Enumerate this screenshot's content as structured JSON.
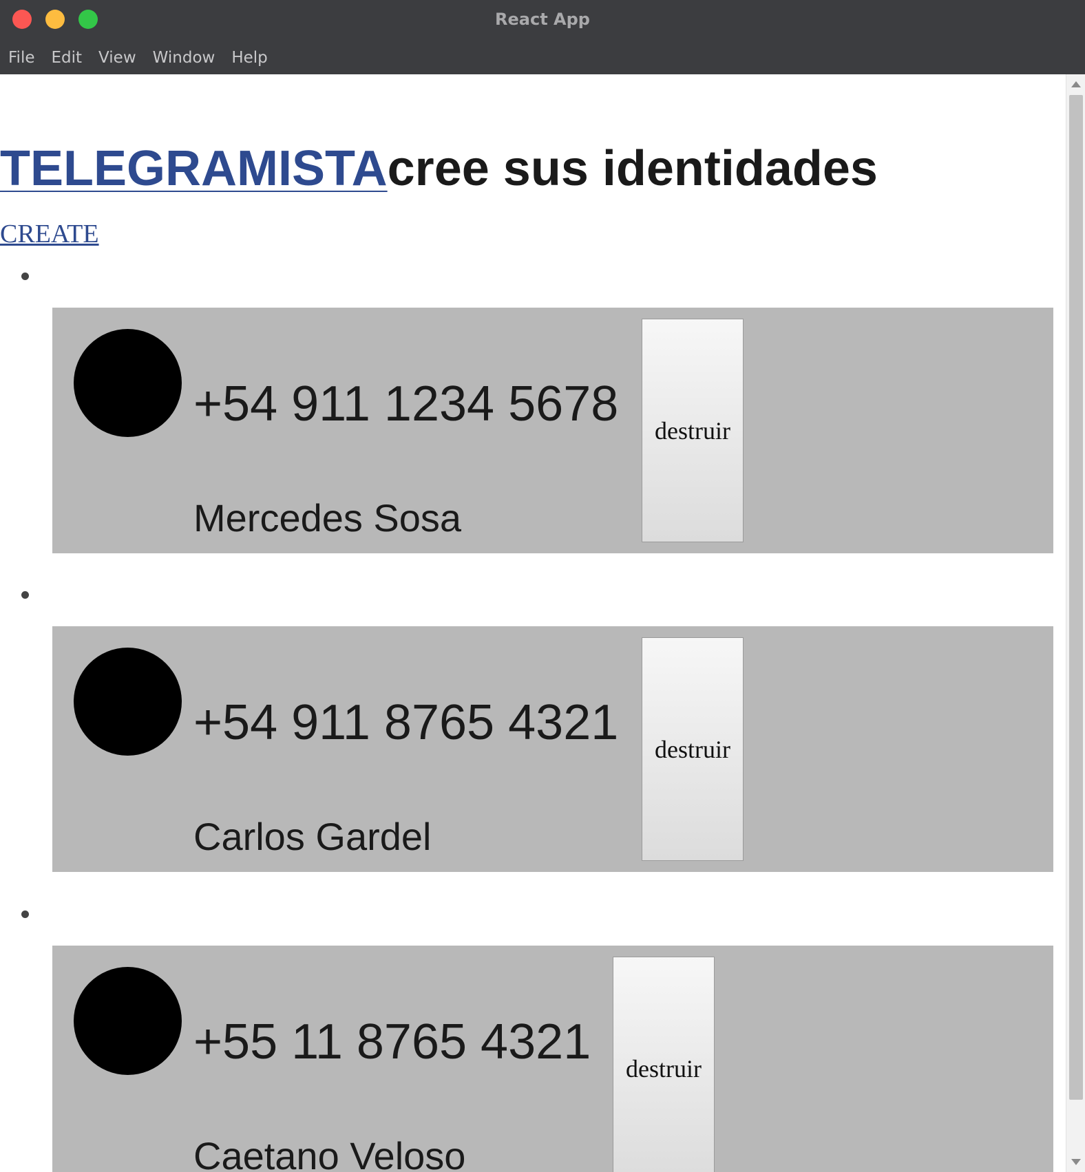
{
  "window": {
    "title": "React App"
  },
  "menu": [
    "File",
    "Edit",
    "View",
    "Window",
    "Help"
  ],
  "header": {
    "brand": "TELEGRAMISTA",
    "subtitle": "cree sus identidades"
  },
  "create_link": "CREATE",
  "identities": [
    {
      "phone": "+54 911 1234 5678",
      "name": "Mercedes Sosa",
      "button": "destruir"
    },
    {
      "phone": "+54 911 8765 4321",
      "name": "Carlos Gardel",
      "button": "destruir"
    },
    {
      "phone": "+55 11 8765 4321",
      "name": "Caetano Veloso",
      "button": "destruir"
    }
  ],
  "colors": {
    "card_bg": "#b8b8b8",
    "link": "#2e4a8f",
    "titlebar": "#3c3d40"
  }
}
